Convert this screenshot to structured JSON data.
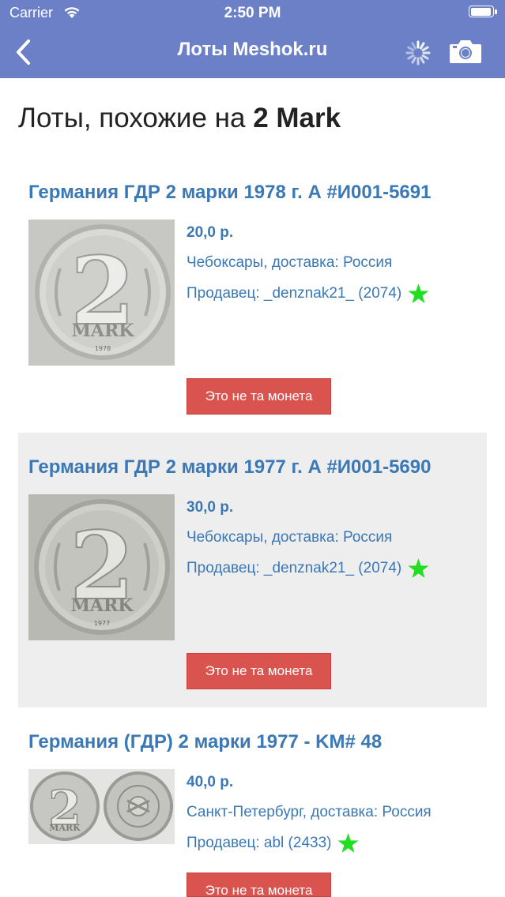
{
  "status_bar": {
    "carrier": "Carrier",
    "time": "2:50 PM"
  },
  "nav": {
    "title": "Лоты Meshok.ru",
    "icons": [
      "back-chevron-icon",
      "activity-spinner-icon",
      "camera-icon"
    ]
  },
  "page": {
    "title_prefix": "Лоты, похожие на ",
    "title_bold": "2 Mark"
  },
  "lots": [
    {
      "title": "Германия ГДР 2 марки 1978 г. А #И001-5691",
      "price": "20,0 р.",
      "location": "Чебоксары, доставка: Россия",
      "seller": "Продавец: _denznak21_ (2074)",
      "button": "Это не та монета",
      "image_text": [
        "2",
        "MARK",
        "1978"
      ]
    },
    {
      "title": "Германия ГДР 2 марки 1977 г. А #И001-5690",
      "price": "30,0 р.",
      "location": "Чебоксары, доставка: Россия",
      "seller": "Продавец: _denznak21_ (2074)",
      "button": "Это не та монета",
      "image_text": [
        "2",
        "MARK",
        "1977"
      ]
    },
    {
      "title": "Германия (ГДР) 2 марки 1977 - KM# 48",
      "price": "40,0 р.",
      "location": "Санкт-Петербург, доставка: Россия",
      "seller": "Продавец: abl (2433)",
      "button": "Это не та монета",
      "image_text": [
        "2",
        "MARK"
      ]
    }
  ],
  "colors": {
    "navbar": "#6b80c7",
    "link": "#3a78b6",
    "button": "#d9534f",
    "star": "#22dd22",
    "alt_row": "#eeeeee"
  }
}
